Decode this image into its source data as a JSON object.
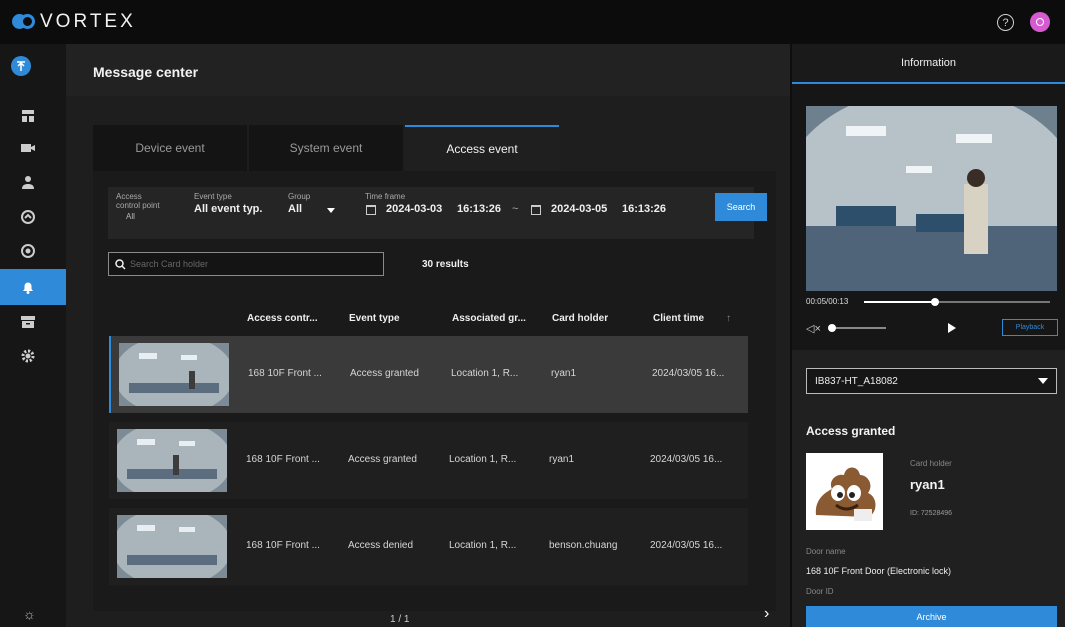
{
  "app": {
    "brand": "VORTEX",
    "accent_color": "#2f8bd9",
    "notification_avatar_color": "#d65bd1"
  },
  "topbar": {
    "help_icon": "question-circle-icon",
    "help_glyph": "?"
  },
  "sidebar": {
    "items": [
      {
        "name": "dashboard",
        "icon": "dashboard-icon"
      },
      {
        "name": "devices",
        "icon": "camera-icon"
      },
      {
        "name": "people",
        "icon": "person-icon"
      },
      {
        "name": "access",
        "icon": "access-control-icon"
      },
      {
        "name": "monitor",
        "icon": "target-icon"
      },
      {
        "name": "messages",
        "icon": "bell-icon",
        "active": true
      },
      {
        "name": "archive",
        "icon": "archive-icon"
      },
      {
        "name": "settings",
        "icon": "gear-icon"
      }
    ]
  },
  "main": {
    "title": "Message center",
    "tabs": [
      {
        "label": "Device event"
      },
      {
        "label": "System event"
      },
      {
        "label": "Access event",
        "active": true
      }
    ],
    "filters": {
      "access_point_label_1": "Access",
      "access_point_label_2": "control point",
      "access_point_value": "All",
      "event_type_label": "Event type",
      "event_type_value": "All event typ.",
      "group_label": "Group",
      "group_value": "All",
      "time_frame_label": "Time frame",
      "start_date": "2024-03-03",
      "start_time": "16:13:26",
      "range_sep": "~",
      "end_date": "2024-03-05",
      "end_time": "16:13:26",
      "search_button": "Search"
    },
    "search": {
      "placeholder": "Search Card holder",
      "results": "30 results"
    },
    "table": {
      "columns": [
        "Access contr...",
        "Event type",
        "Associated gr...",
        "Card holder",
        "Client time"
      ],
      "sort_indicator": "↑",
      "rows": [
        {
          "access_point": "168 10F Front ...",
          "event_type": "Access granted",
          "group": "Location 1, R...",
          "card_holder": "ryan1",
          "client_time": "2024/03/05 16...",
          "selected": true
        },
        {
          "access_point": "168 10F Front ...",
          "event_type": "Access granted",
          "group": "Location 1, R...",
          "card_holder": "ryan1",
          "client_time": "2024/03/05 16..."
        },
        {
          "access_point": "168 10F Front ...",
          "event_type": "Access denied",
          "group": "Location 1, R...",
          "card_holder": "benson.chuang",
          "client_time": "2024/03/05 16..."
        }
      ]
    },
    "pagination": {
      "label": "1 / 1"
    }
  },
  "info": {
    "tab_label": "Information",
    "video": {
      "time": "00:05/00:13",
      "progress": 0.38,
      "volume": 0.05,
      "playback_button": "Playback"
    },
    "device": "IB837-HT_A18082",
    "event_status": "Access granted",
    "card_holder_label": "Card holder",
    "card_holder_name": "ryan1",
    "card_id": "ID: 72528496",
    "door_name_label": "Door name",
    "door_name": "168 10F Front Door (Electronic lock)",
    "door_id_label": "Door ID",
    "archive_button": "Archive"
  }
}
